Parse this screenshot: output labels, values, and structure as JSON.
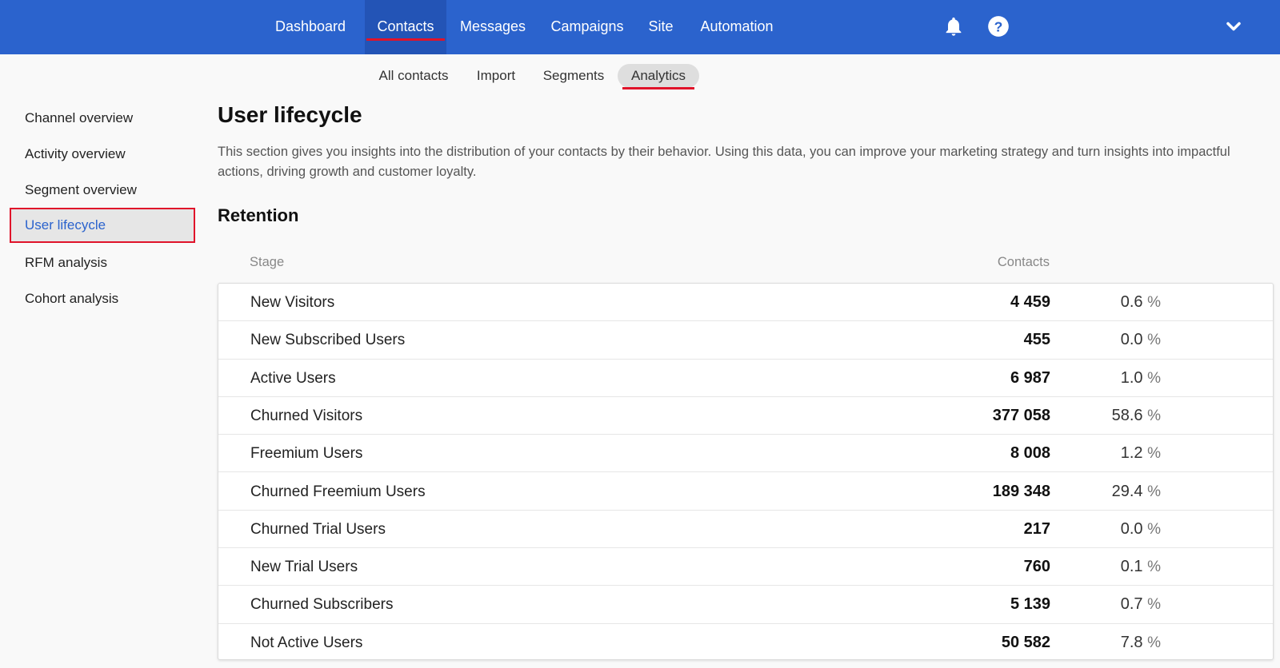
{
  "nav": {
    "items": [
      {
        "label": "Dashboard"
      },
      {
        "label": "Contacts"
      },
      {
        "label": "Messages"
      },
      {
        "label": "Campaigns"
      },
      {
        "label": "Site"
      },
      {
        "label": "Automation"
      }
    ],
    "active": "Contacts",
    "icons": [
      "bell-icon",
      "help-icon",
      "chevron-down-icon"
    ]
  },
  "subtabs": {
    "items": [
      {
        "label": "All contacts"
      },
      {
        "label": "Import"
      },
      {
        "label": "Segments"
      },
      {
        "label": "Analytics"
      }
    ],
    "active": "Analytics"
  },
  "sidebar": {
    "items": [
      {
        "label": "Channel overview"
      },
      {
        "label": "Activity overview"
      },
      {
        "label": "Segment overview"
      },
      {
        "label": "User lifecycle"
      },
      {
        "label": "RFM analysis"
      },
      {
        "label": "Cohort analysis"
      }
    ],
    "active": "User lifecycle"
  },
  "main": {
    "title": "User lifecycle",
    "description": "This section gives you insights into the distribution of your contacts by their behavior. Using this data, you can improve your marketing strategy and turn insights into impactful actions, driving growth and customer loyalty.",
    "section_title": "Retention",
    "columns": {
      "stage": "Stage",
      "contacts": "Contacts"
    },
    "rows": [
      {
        "stage": "New Visitors",
        "count": "4 459",
        "pct": "0.6"
      },
      {
        "stage": "New Subscribed Users",
        "count": "455",
        "pct": "0.0"
      },
      {
        "stage": "Active Users",
        "count": "6 987",
        "pct": "1.0"
      },
      {
        "stage": "Churned Visitors",
        "count": "377 058",
        "pct": "58.6"
      },
      {
        "stage": "Freemium Users",
        "count": "8 008",
        "pct": "1.2"
      },
      {
        "stage": "Churned Freemium Users",
        "count": "189 348",
        "pct": "29.4"
      },
      {
        "stage": "Churned Trial Users",
        "count": "217",
        "pct": "0.0"
      },
      {
        "stage": "New Trial Users",
        "count": "760",
        "pct": "0.1"
      },
      {
        "stage": "Churned Subscribers",
        "count": "5 139",
        "pct": "0.7"
      },
      {
        "stage": "Not Active Users",
        "count": "50 582",
        "pct": "7.8"
      }
    ],
    "pct_sign": "%"
  },
  "colors": {
    "brand": "#2b63cd",
    "accent": "#e0132a"
  }
}
